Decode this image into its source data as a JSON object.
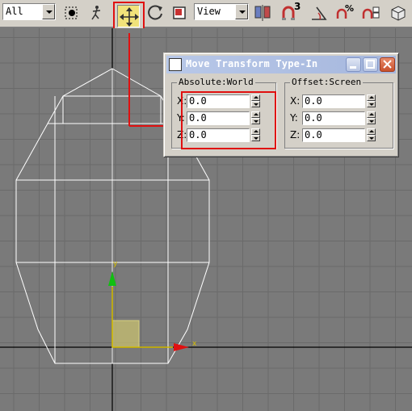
{
  "toolbar": {
    "selection_filter": "All",
    "reference_coord_system": "View",
    "icons": [
      "select-object-icon",
      "select-link-icon",
      "select-and-move-icon",
      "select-and-rotate-icon",
      "select-and-scale-icon",
      "mirror-icon",
      "snap-3d-icon",
      "angle-snap-icon",
      "percent-snap-icon",
      "spinner-snap-icon",
      "render-icon"
    ],
    "snap_label": "3"
  },
  "dialog": {
    "title": "Move Transform Type-In",
    "absolute": {
      "legend": "Absolute:World",
      "x_label": "X:",
      "x_value": "0.0",
      "y_label": "Y:",
      "y_value": "0.0",
      "z_label": "Z:",
      "z_value": "0.0"
    },
    "offset": {
      "legend": "Offset:Screen",
      "x_label": "X:",
      "x_value": "0.0",
      "y_label": "Y:",
      "y_value": "0.0",
      "z_label": "Z:",
      "z_value": "0.0"
    }
  },
  "viewport": {
    "gizmo_x_label": "x",
    "gizmo_y_label": "y",
    "gizmo_x_color": "#e01010",
    "gizmo_y_color": "#10c010",
    "gizmo_plane_color": "#c8c070"
  },
  "colors": {
    "highlight": "#e01010",
    "move_button_active": "#f1e27a"
  }
}
